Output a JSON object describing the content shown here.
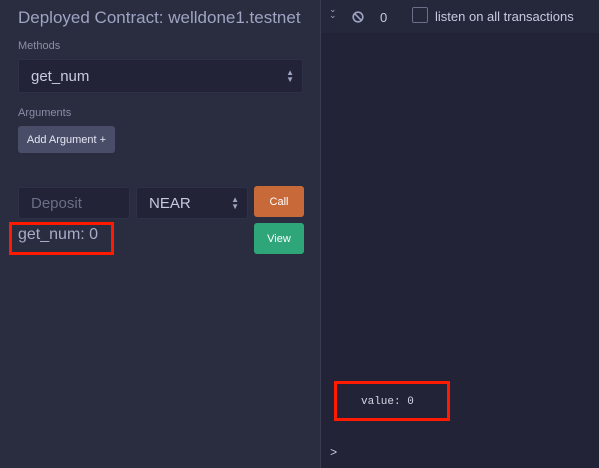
{
  "left_panel": {
    "title": "Deployed Contract: welldone1.testnet",
    "methods_label": "Methods",
    "method_selected": "get_num",
    "arguments_label": "Arguments",
    "add_argument_label": "Add Argument +",
    "deposit_placeholder": "Deposit",
    "unit_selected": "NEAR",
    "call_label": "Call",
    "view_label": "View",
    "result_text": "get_num: 0"
  },
  "terminal": {
    "tx_count": "0",
    "listen_label": "listen on all transactions",
    "listen_checked": false,
    "output_line": "value: 0",
    "prompt": ">"
  },
  "colors": {
    "left_panel_bg": "#2a2c3f",
    "terminal_bg": "#222336",
    "call_button": "#c8693a",
    "view_button": "#2fa57a",
    "highlight_box": "#ff1a00"
  },
  "icons": [
    "double-chevron-down-icon",
    "ban-icon",
    "updown-chevron-icon"
  ]
}
